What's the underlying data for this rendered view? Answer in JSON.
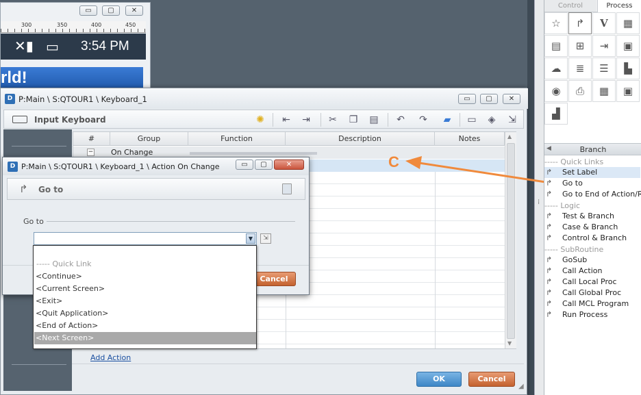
{
  "bg_window": {
    "ruler_ticks": [
      "300",
      "350",
      "400",
      "450"
    ],
    "time": "3:54 PM",
    "banner_text": "rld!"
  },
  "main_dialog": {
    "title": "P:Main \\ S:QTOUR1 \\ Keyboard_1",
    "header_label": "Input Keyboard",
    "columns": [
      "#",
      "Group",
      "Function",
      "Description",
      "Notes"
    ],
    "group_row_toggle": "−",
    "group_row_label": "On Change",
    "add_action": "Add Action",
    "ok": "OK",
    "cancel": "Cancel"
  },
  "inner_dialog": {
    "title": "P:Main \\ S:QTOUR1 \\ Keyboard_1 \\ Action On Change",
    "header_label": "Go to",
    "field_label": "Go to",
    "field_value": "",
    "cancel": "Cancel",
    "dropdown_options": [
      "----- Quick Link",
      "<Continue>",
      "<Current Screen>",
      "<Exit>",
      "<Quit Application>",
      "<End of Action>",
      "<Next Screen>"
    ],
    "selected_index": 6
  },
  "annotation": {
    "letter": "C",
    "color": "#f08a3c"
  },
  "right_panel": {
    "tabs": [
      "Control",
      "Process"
    ],
    "active_tab": "Process",
    "section_title": "Branch",
    "groups": [
      {
        "category": "----- Quick Links",
        "items": [
          "Set Label",
          "Go to",
          "Go to End of Action/R"
        ]
      },
      {
        "category": "----- Logic",
        "items": [
          "Test & Branch",
          "Case & Branch",
          "Control & Branch"
        ]
      },
      {
        "category": "----- SubRoutine",
        "items": [
          "GoSub",
          "Call Action",
          "Call Local Proc",
          "Call Global Proc",
          "Call MCL Program",
          "Run Process"
        ]
      }
    ]
  },
  "colors": {
    "accent_orange": "#c4622f",
    "accent_blue": "#3d86c6",
    "selection_grey": "#a9a9a9",
    "app_dark": "#55626e"
  }
}
